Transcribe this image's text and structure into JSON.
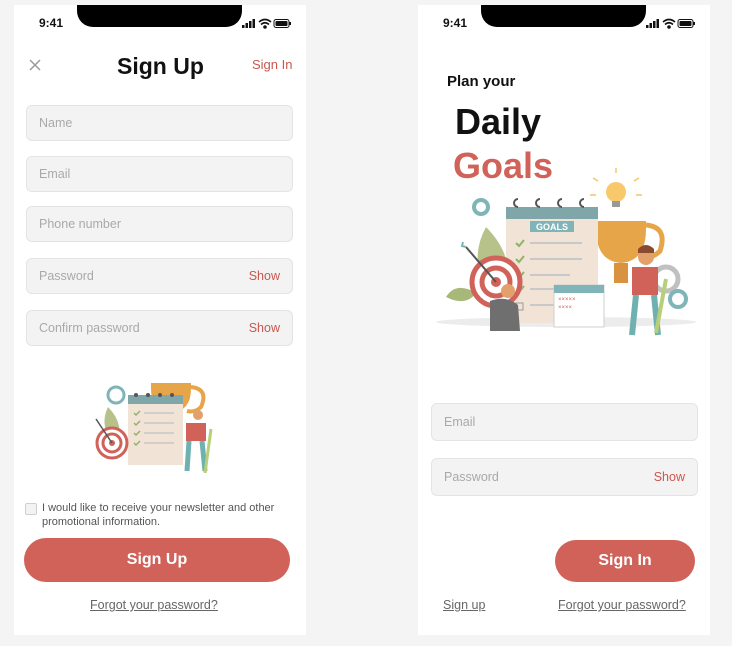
{
  "status": {
    "time": "9:41"
  },
  "signup": {
    "title": "Sign Up",
    "sign_in_link": "Sign In",
    "fields": [
      {
        "placeholder": "Name",
        "action": ""
      },
      {
        "placeholder": "Email",
        "action": ""
      },
      {
        "placeholder": "Phone number",
        "action": ""
      },
      {
        "placeholder": "Password",
        "action": "Show"
      },
      {
        "placeholder": "Confirm password",
        "action": "Show"
      }
    ],
    "newsletter_text": "I would like to receive your newsletter and other promotional information.",
    "submit_label": "Sign Up",
    "forgot_link": "Forgot your password?"
  },
  "signin": {
    "heading_small": "Plan your",
    "heading_line1": "Daily",
    "heading_line2": "Goals",
    "illustration_label": "GOALS",
    "fields": [
      {
        "placeholder": "Email",
        "action": ""
      },
      {
        "placeholder": "Password",
        "action": "Show"
      }
    ],
    "submit_label": "Sign In",
    "signup_link": "Sign up",
    "forgot_link": "Forgot your password?"
  },
  "colors": {
    "accent": "#d0625a",
    "accent_text": "#c9574f",
    "field_bg": "#f3f3f3",
    "page_bg": "#f4f4f4"
  },
  "icons": [
    "close-icon",
    "signal-icon",
    "wifi-icon",
    "battery-icon",
    "checkbox-icon"
  ]
}
